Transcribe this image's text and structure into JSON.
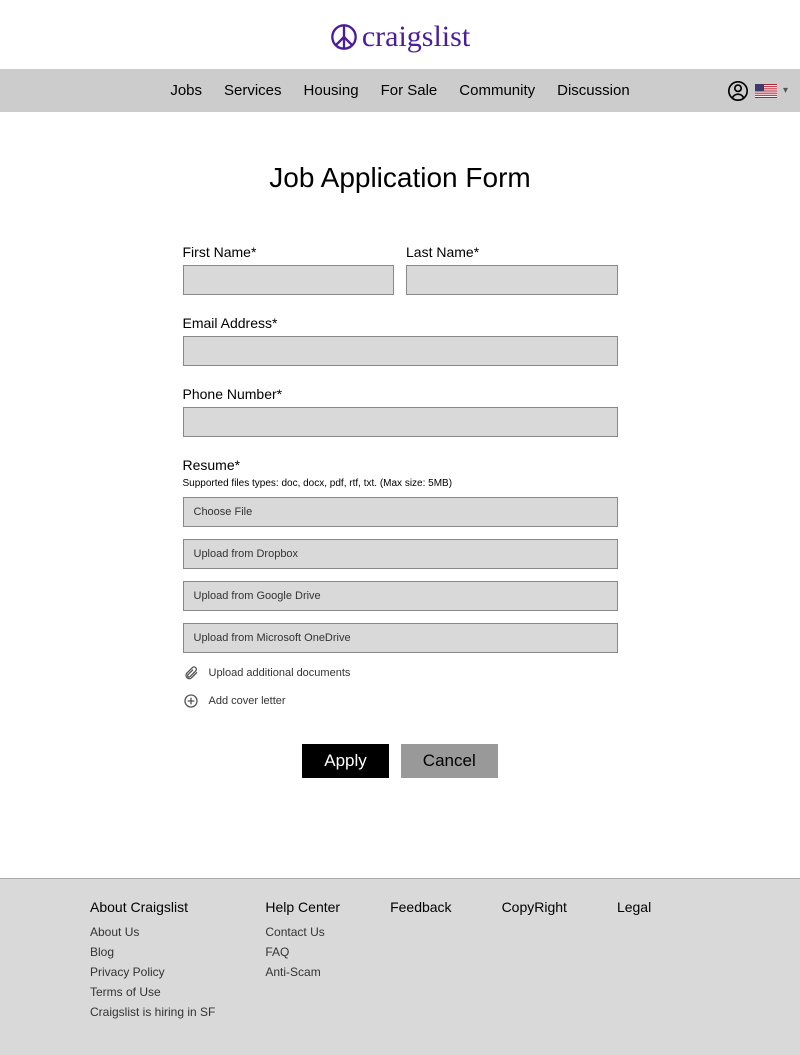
{
  "header": {
    "logo_text": "craigslist"
  },
  "nav": {
    "items": [
      "Jobs",
      "Services",
      "Housing",
      "For Sale",
      "Community",
      "Discussion"
    ]
  },
  "page": {
    "title": "Job Application Form"
  },
  "form": {
    "first_name_label": "First Name*",
    "last_name_label": "Last Name*",
    "email_label": "Email Address*",
    "phone_label": "Phone Number*",
    "resume_label": "Resume*",
    "resume_hint": "Supported files types: doc, docx, pdf, rtf, txt. (Max size: 5MB)",
    "upload_options": [
      "Choose File",
      "Upload from Dropbox",
      "Upload from Google Drive",
      "Upload from Microsoft OneDrive"
    ],
    "additional_docs": "Upload additional documents",
    "cover_letter": "Add cover letter",
    "apply_label": "Apply",
    "cancel_label": "Cancel"
  },
  "footer": {
    "columns": [
      {
        "heading": "About Craigslist",
        "links": [
          "About Us",
          "Blog",
          "Privacy Policy",
          "Terms of Use",
          "Craigslist is hiring in SF"
        ]
      },
      {
        "heading": "Help Center",
        "links": [
          "Contact Us",
          "FAQ",
          "Anti-Scam"
        ]
      }
    ],
    "singles": [
      "Feedback",
      "CopyRight",
      "Legal"
    ]
  }
}
